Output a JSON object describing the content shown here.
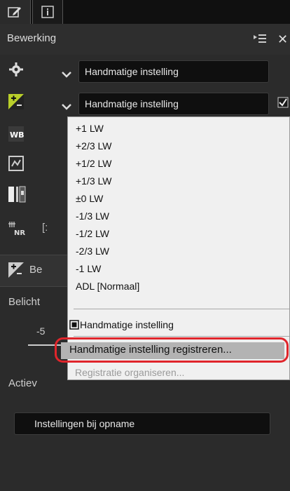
{
  "tabs": [
    {
      "icon": "edit-icon"
    },
    {
      "icon": "info-icon"
    }
  ],
  "panel": {
    "title": "Bewerking"
  },
  "rows": {
    "settings_dropdown": "Handmatige instelling",
    "exposure_dropdown": "Handmatige instelling"
  },
  "menu": {
    "items": [
      "+1 LW",
      "+2/3 LW",
      "+1/2 LW",
      "+1/3 LW",
      "±0 LW",
      "-1/3 LW",
      "-1/2 LW",
      "-2/3 LW",
      "-1 LW",
      "ADL [Normaal]"
    ],
    "manual": "Handmatige instelling",
    "register": "Handmatige instelling registreren...",
    "organise": "Registratie organiseren..."
  },
  "left_labels": {
    "section_short": "Be",
    "belicht": "Belicht",
    "value": "-5",
    "actief": "Actiev"
  },
  "bottom_dropdown": "Instellingen bij opname"
}
